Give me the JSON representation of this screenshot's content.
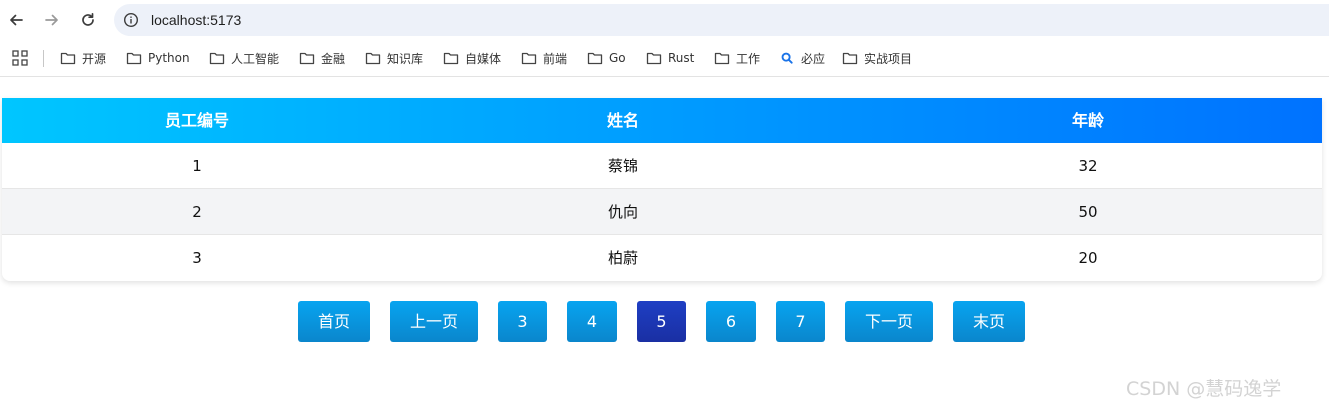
{
  "browser": {
    "url": "localhost:5173",
    "bookmarks": [
      {
        "label": "开源",
        "icon": "folder-icon"
      },
      {
        "label": "Python",
        "icon": "folder-icon"
      },
      {
        "label": "人工智能",
        "icon": "folder-icon"
      },
      {
        "label": "金融",
        "icon": "folder-icon"
      },
      {
        "label": "知识库",
        "icon": "folder-icon"
      },
      {
        "label": "自媒体",
        "icon": "folder-icon"
      },
      {
        "label": "前端",
        "icon": "folder-icon"
      },
      {
        "label": "Go",
        "icon": "folder-icon"
      },
      {
        "label": "Rust",
        "icon": "folder-icon"
      },
      {
        "label": "工作",
        "icon": "folder-icon"
      },
      {
        "label": "必应",
        "icon": "search-icon"
      },
      {
        "label": "实战项目",
        "icon": "folder-icon"
      }
    ]
  },
  "table": {
    "headers": [
      "员工编号",
      "姓名",
      "年龄"
    ],
    "rows": [
      [
        "1",
        "蔡锦",
        "32"
      ],
      [
        "2",
        "仇向",
        "50"
      ],
      [
        "3",
        "柏蔚",
        "20"
      ]
    ]
  },
  "pagination": {
    "first": "首页",
    "prev": "上一页",
    "pages": [
      "3",
      "4",
      "5",
      "6",
      "7"
    ],
    "current": "5",
    "next": "下一页",
    "last": "末页"
  },
  "watermark": "CSDN @慧码逸学",
  "colors": {
    "header_gradient_start": "#00c6ff",
    "header_gradient_end": "#0072ff",
    "button": "#0a94de",
    "button_active": "#1e35b8"
  }
}
